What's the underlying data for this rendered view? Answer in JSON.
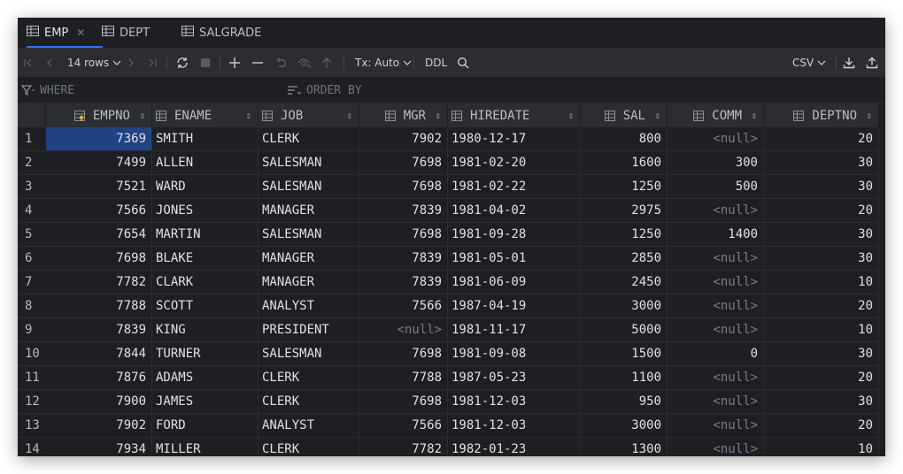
{
  "tabs": [
    {
      "label": "EMP",
      "active": true,
      "closable": true
    },
    {
      "label": "DEPT",
      "active": false
    },
    {
      "label": "SALGRADE",
      "active": false
    }
  ],
  "toolbar": {
    "rows_label": "14 rows",
    "tx_label": "Tx: Auto",
    "ddl_label": "DDL",
    "format_label": "CSV"
  },
  "filter": {
    "where_placeholder": "WHERE",
    "order_placeholder": "ORDER BY"
  },
  "grid": {
    "columns": [
      {
        "name": "EMPNO",
        "icon": "primary-key-column-icon",
        "align": "right"
      },
      {
        "name": "ENAME",
        "icon": "column-icon",
        "align": "left"
      },
      {
        "name": "JOB",
        "icon": "column-icon",
        "align": "left"
      },
      {
        "name": "MGR",
        "icon": "column-icon",
        "align": "right"
      },
      {
        "name": "HIREDATE",
        "icon": "column-icon",
        "align": "left"
      },
      {
        "name": "SAL",
        "icon": "column-icon",
        "align": "right"
      },
      {
        "name": "COMM",
        "icon": "column-icon",
        "align": "right"
      },
      {
        "name": "DEPTNO",
        "icon": "column-icon",
        "align": "right"
      }
    ],
    "rows": [
      {
        "n": "1",
        "cells": [
          "7369",
          "SMITH",
          "CLERK",
          "7902",
          "1980-12-17",
          "800",
          "<null>",
          "20"
        ]
      },
      {
        "n": "2",
        "cells": [
          "7499",
          "ALLEN",
          "SALESMAN",
          "7698",
          "1981-02-20",
          "1600",
          "300",
          "30"
        ]
      },
      {
        "n": "3",
        "cells": [
          "7521",
          "WARD",
          "SALESMAN",
          "7698",
          "1981-02-22",
          "1250",
          "500",
          "30"
        ]
      },
      {
        "n": "4",
        "cells": [
          "7566",
          "JONES",
          "MANAGER",
          "7839",
          "1981-04-02",
          "2975",
          "<null>",
          "20"
        ]
      },
      {
        "n": "5",
        "cells": [
          "7654",
          "MARTIN",
          "SALESMAN",
          "7698",
          "1981-09-28",
          "1250",
          "1400",
          "30"
        ]
      },
      {
        "n": "6",
        "cells": [
          "7698",
          "BLAKE",
          "MANAGER",
          "7839",
          "1981-05-01",
          "2850",
          "<null>",
          "30"
        ]
      },
      {
        "n": "7",
        "cells": [
          "7782",
          "CLARK",
          "MANAGER",
          "7839",
          "1981-06-09",
          "2450",
          "<null>",
          "10"
        ]
      },
      {
        "n": "8",
        "cells": [
          "7788",
          "SCOTT",
          "ANALYST",
          "7566",
          "1987-04-19",
          "3000",
          "<null>",
          "20"
        ]
      },
      {
        "n": "9",
        "cells": [
          "7839",
          "KING",
          "PRESIDENT",
          "<null>",
          "1981-11-17",
          "5000",
          "<null>",
          "10"
        ]
      },
      {
        "n": "10",
        "cells": [
          "7844",
          "TURNER",
          "SALESMAN",
          "7698",
          "1981-09-08",
          "1500",
          "0",
          "30"
        ]
      },
      {
        "n": "11",
        "cells": [
          "7876",
          "ADAMS",
          "CLERK",
          "7788",
          "1987-05-23",
          "1100",
          "<null>",
          "20"
        ]
      },
      {
        "n": "12",
        "cells": [
          "7900",
          "JAMES",
          "CLERK",
          "7698",
          "1981-12-03",
          "950",
          "<null>",
          "30"
        ]
      },
      {
        "n": "13",
        "cells": [
          "7902",
          "FORD",
          "ANALYST",
          "7566",
          "1981-12-03",
          "3000",
          "<null>",
          "20"
        ]
      },
      {
        "n": "14",
        "cells": [
          "7934",
          "MILLER",
          "CLERK",
          "7782",
          "1982-01-23",
          "1300",
          "<null>",
          "10"
        ]
      }
    ],
    "selected_cell": {
      "row": 0,
      "col": 0
    }
  },
  "colors": {
    "background": "#1e1f22",
    "toolbar": "#2b2d30",
    "selection": "#214283",
    "accent": "#3574f0",
    "null_text": "#7a7e85"
  }
}
